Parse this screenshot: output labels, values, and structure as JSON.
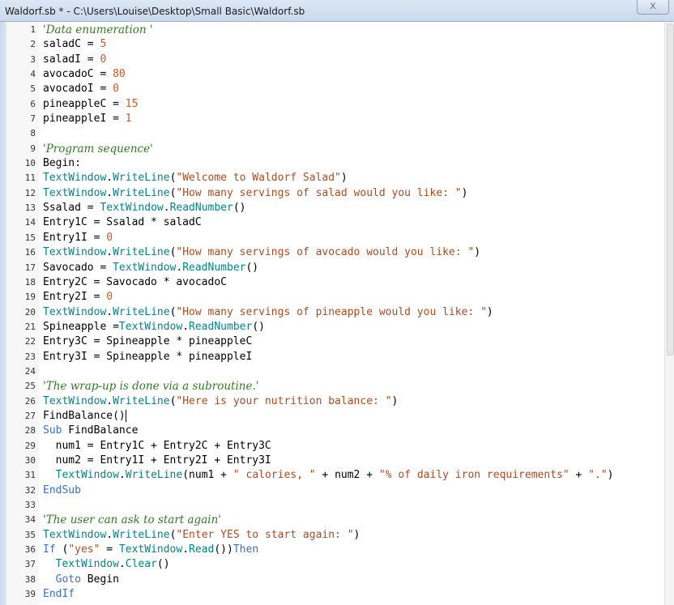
{
  "window": {
    "title": "Waldorf.sb * - C:\\Users\\Louise\\Desktop\\Small Basic\\Waldorf.sb",
    "close_label": "x"
  },
  "colors": {
    "keyword": "#3b6fc4",
    "object": "#00858a",
    "string": "#b04a1e",
    "number": "#d4561e",
    "comment": "#2e7d1f",
    "plain": "#000000"
  },
  "lines": [
    {
      "n": "1",
      "t": [
        [
          "c",
          "'Data enumeration '"
        ]
      ]
    },
    {
      "n": "2",
      "t": [
        [
          "p",
          "saladC = "
        ],
        [
          "n",
          "5"
        ]
      ]
    },
    {
      "n": "3",
      "t": [
        [
          "p",
          "saladI = "
        ],
        [
          "n",
          "0"
        ]
      ]
    },
    {
      "n": "4",
      "t": [
        [
          "p",
          "avocadoC = "
        ],
        [
          "n",
          "80"
        ]
      ]
    },
    {
      "n": "5",
      "t": [
        [
          "p",
          "avocadoI = "
        ],
        [
          "n",
          "0"
        ]
      ]
    },
    {
      "n": "6",
      "t": [
        [
          "p",
          "pineappleC = "
        ],
        [
          "n",
          "15"
        ]
      ]
    },
    {
      "n": "7",
      "t": [
        [
          "p",
          "pineappleI = "
        ],
        [
          "n",
          "1"
        ]
      ]
    },
    {
      "n": "8",
      "t": []
    },
    {
      "n": "9",
      "t": [
        [
          "c",
          "'Program sequence'"
        ]
      ]
    },
    {
      "n": "10",
      "t": [
        [
          "p",
          "Begin:"
        ]
      ]
    },
    {
      "n": "11",
      "t": [
        [
          "o",
          "TextWindow"
        ],
        [
          "p",
          "."
        ],
        [
          "o",
          "WriteLine"
        ],
        [
          "p",
          "("
        ],
        [
          "s",
          "\"Welcome to Waldorf Salad\""
        ],
        [
          "p",
          ")"
        ]
      ]
    },
    {
      "n": "12",
      "t": [
        [
          "o",
          "TextWindow"
        ],
        [
          "p",
          "."
        ],
        [
          "o",
          "WriteLine"
        ],
        [
          "p",
          "("
        ],
        [
          "s",
          "\"How many servings of salad would you like: \""
        ],
        [
          "p",
          ")"
        ]
      ]
    },
    {
      "n": "13",
      "t": [
        [
          "p",
          "Ssalad = "
        ],
        [
          "o",
          "TextWindow"
        ],
        [
          "p",
          "."
        ],
        [
          "o",
          "ReadNumber"
        ],
        [
          "p",
          "()"
        ]
      ]
    },
    {
      "n": "14",
      "t": [
        [
          "p",
          "Entry1C = Ssalad * saladC"
        ]
      ]
    },
    {
      "n": "15",
      "t": [
        [
          "p",
          "Entry1I = "
        ],
        [
          "n",
          "0"
        ]
      ]
    },
    {
      "n": "16",
      "t": [
        [
          "o",
          "TextWindow"
        ],
        [
          "p",
          "."
        ],
        [
          "o",
          "WriteLine"
        ],
        [
          "p",
          "("
        ],
        [
          "s",
          "\"How many servings of avocado would you like: \""
        ],
        [
          "p",
          ")"
        ]
      ]
    },
    {
      "n": "17",
      "t": [
        [
          "p",
          "Savocado = "
        ],
        [
          "o",
          "TextWindow"
        ],
        [
          "p",
          "."
        ],
        [
          "o",
          "ReadNumber"
        ],
        [
          "p",
          "()"
        ]
      ]
    },
    {
      "n": "18",
      "t": [
        [
          "p",
          "Entry2C = Savocado * avocadoC"
        ]
      ]
    },
    {
      "n": "19",
      "t": [
        [
          "p",
          "Entry2I = "
        ],
        [
          "n",
          "0"
        ]
      ]
    },
    {
      "n": "20",
      "t": [
        [
          "o",
          "TextWindow"
        ],
        [
          "p",
          "."
        ],
        [
          "o",
          "WriteLine"
        ],
        [
          "p",
          "("
        ],
        [
          "s",
          "\"How many servings of pineapple would you like: \""
        ],
        [
          "p",
          ")"
        ]
      ]
    },
    {
      "n": "21",
      "t": [
        [
          "p",
          "Spineapple ="
        ],
        [
          "o",
          "TextWindow"
        ],
        [
          "p",
          "."
        ],
        [
          "o",
          "ReadNumber"
        ],
        [
          "p",
          "()"
        ]
      ]
    },
    {
      "n": "22",
      "t": [
        [
          "p",
          "Entry3C = Spineapple * pineappleC"
        ]
      ]
    },
    {
      "n": "23",
      "t": [
        [
          "p",
          "Entry3I = Spineapple * pineappleI"
        ]
      ]
    },
    {
      "n": "24",
      "t": []
    },
    {
      "n": "25",
      "t": [
        [
          "c",
          "'The wrap-up is done via a subroutine.'"
        ]
      ]
    },
    {
      "n": "26",
      "t": [
        [
          "o",
          "TextWindow"
        ],
        [
          "p",
          "."
        ],
        [
          "o",
          "WriteLine"
        ],
        [
          "p",
          "("
        ],
        [
          "s",
          "\"Here is your nutrition balance: \""
        ],
        [
          "p",
          ")"
        ]
      ]
    },
    {
      "n": "27",
      "t": [
        [
          "p",
          "FindBalance()"
        ]
      ]
    },
    {
      "n": "28",
      "t": [
        [
          "k",
          "Sub"
        ],
        [
          "p",
          " FindBalance"
        ]
      ]
    },
    {
      "n": "29",
      "t": [
        [
          "p",
          "  num1 = Entry1C + Entry2C + Entry3C"
        ]
      ]
    },
    {
      "n": "30",
      "t": [
        [
          "p",
          "  num2 = Entry1I + Entry2I + Entry3I"
        ]
      ]
    },
    {
      "n": "31",
      "t": [
        [
          "p",
          "  "
        ],
        [
          "o",
          "TextWindow"
        ],
        [
          "p",
          "."
        ],
        [
          "o",
          "WriteLine"
        ],
        [
          "p",
          "(num1 + "
        ],
        [
          "s",
          "\" calories, \""
        ],
        [
          "p",
          " + num2 + "
        ],
        [
          "s",
          "\"% of daily iron requirements\""
        ],
        [
          "p",
          " + "
        ],
        [
          "s",
          "\".\""
        ],
        [
          "p",
          ")"
        ]
      ]
    },
    {
      "n": "32",
      "t": [
        [
          "k",
          "EndSub"
        ]
      ]
    },
    {
      "n": "33",
      "t": []
    },
    {
      "n": "34",
      "t": [
        [
          "c",
          "'The user can ask to start again'"
        ]
      ]
    },
    {
      "n": "35",
      "t": [
        [
          "o",
          "TextWindow"
        ],
        [
          "p",
          "."
        ],
        [
          "o",
          "WriteLine"
        ],
        [
          "p",
          "("
        ],
        [
          "s",
          "\"Enter YES to start again: \""
        ],
        [
          "p",
          ")"
        ]
      ]
    },
    {
      "n": "36",
      "t": [
        [
          "k",
          "If"
        ],
        [
          "p",
          " ("
        ],
        [
          "s",
          "\"yes\""
        ],
        [
          "p",
          " = "
        ],
        [
          "o",
          "TextWindow"
        ],
        [
          "p",
          "."
        ],
        [
          "o",
          "Read"
        ],
        [
          "p",
          "())"
        ],
        [
          "k",
          "Then"
        ]
      ]
    },
    {
      "n": "37",
      "t": [
        [
          "p",
          "  "
        ],
        [
          "o",
          "TextWindow"
        ],
        [
          "p",
          "."
        ],
        [
          "o",
          "Clear"
        ],
        [
          "p",
          "()"
        ]
      ]
    },
    {
      "n": "38",
      "t": [
        [
          "p",
          "  "
        ],
        [
          "k",
          "Goto"
        ],
        [
          "p",
          " Begin"
        ]
      ]
    },
    {
      "n": "39",
      "t": [
        [
          "k",
          "EndIf"
        ]
      ]
    }
  ],
  "caret_line": "27"
}
